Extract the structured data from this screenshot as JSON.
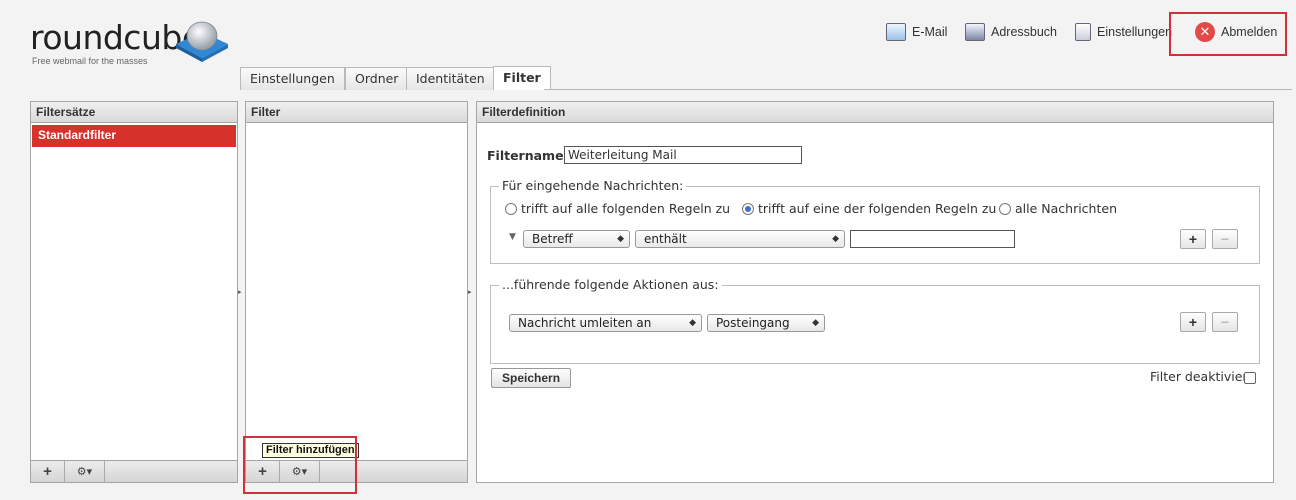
{
  "logo": {
    "wordmark": "roundcube",
    "tagline": "Free webmail for the masses"
  },
  "topnav": {
    "mail": "E-Mail",
    "addressbook": "Adressbuch",
    "settings": "Einstellungen",
    "logout": "Abmelden"
  },
  "tabs": [
    "Einstellungen",
    "Ordner",
    "Identitäten",
    "Filter"
  ],
  "filtersets": {
    "header": "Filtersätze",
    "items": [
      "Standardfilter"
    ]
  },
  "filters": {
    "header": "Filter",
    "tooltip": "Filter hinzufügen"
  },
  "footer_buttons": {
    "add": "+",
    "actions": "⚙▾"
  },
  "definition": {
    "header": "Filterdefinition",
    "name_label": "Filtername:",
    "name_value": "Weiterleitung Mail",
    "incoming_legend": "Für eingehende Nachrichten:",
    "match_all": "trifft auf alle folgenden Regeln zu",
    "match_any": "trifft auf eine der folgenden Regeln zu",
    "match_every_message": "alle Nachrichten",
    "rule": {
      "header": "Betreff",
      "operator": "enthält",
      "value": ""
    },
    "actions_legend": "...führende folgende Aktionen aus:",
    "action": {
      "type": "Nachricht umleiten an",
      "target": "Posteingang"
    },
    "save": "Speichern",
    "disabled_label": "Filter deaktiviert",
    "plus": "+",
    "minus": "−"
  }
}
